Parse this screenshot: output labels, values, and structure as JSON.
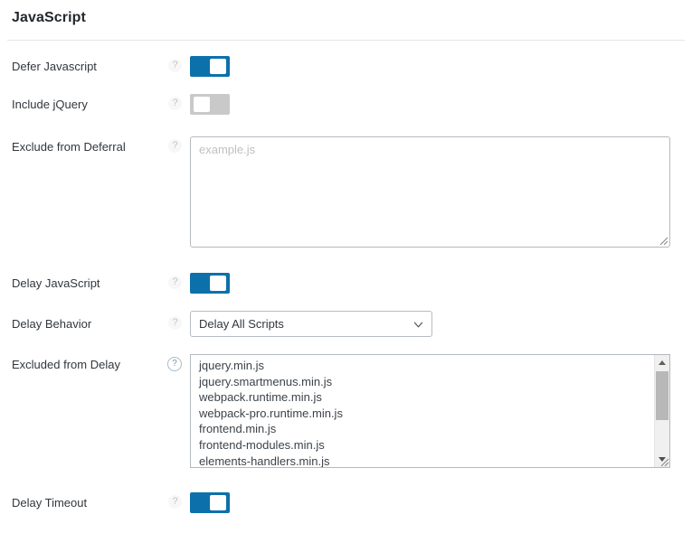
{
  "section": {
    "title": "JavaScript"
  },
  "help_icon_glyph": "?",
  "rows": {
    "defer_javascript": {
      "label": "Defer Javascript",
      "toggle_state": "on"
    },
    "include_jquery": {
      "label": "Include jQuery",
      "toggle_state": "off"
    },
    "exclude_from_deferral": {
      "label": "Exclude from Deferral",
      "placeholder": "example.js",
      "value": ""
    },
    "delay_javascript": {
      "label": "Delay JavaScript",
      "toggle_state": "on"
    },
    "delay_behavior": {
      "label": "Delay Behavior",
      "selected": "Delay All Scripts",
      "options": [
        "Delay All Scripts"
      ]
    },
    "excluded_from_delay": {
      "label": "Excluded from Delay",
      "items": [
        "jquery.min.js",
        "jquery.smartmenus.min.js",
        "webpack.runtime.min.js",
        "webpack-pro.runtime.min.js",
        "frontend.min.js",
        "frontend-modules.min.js",
        "elements-handlers.min.js"
      ]
    },
    "delay_timeout": {
      "label": "Delay Timeout",
      "toggle_state": "on"
    }
  },
  "colors": {
    "toggle_on": "#0c71ab",
    "toggle_off": "#c9c9c9",
    "text": "#32373c",
    "border": "#b4b9be",
    "help_active": "#a6bcce"
  }
}
